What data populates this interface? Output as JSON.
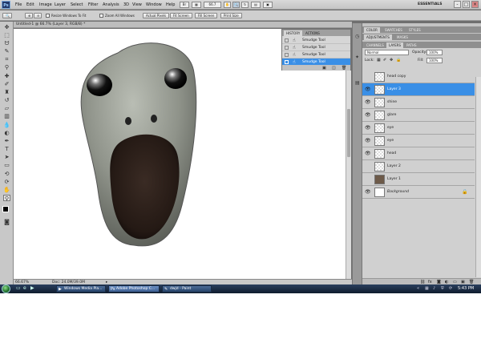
{
  "menubar": {
    "logo": "Ps",
    "items": [
      "File",
      "Edit",
      "Image",
      "Layer",
      "Select",
      "Filter",
      "Analysis",
      "3D",
      "View",
      "Window",
      "Help"
    ],
    "zoom": "66.7",
    "workspace": "ESSENTIALS",
    "window_controls": [
      "-",
      "□",
      "×"
    ]
  },
  "options": {
    "resize_windows": "Resize Windows To Fit",
    "zoom_all": "Zoom All Windows",
    "actual_pixels": "Actual Pixels",
    "fit_screen": "Fit Screen",
    "fill_screen": "Fill Screen",
    "print_size": "Print Size"
  },
  "document": {
    "title": "Untitled-1 @ 66.7% (Layer 3, RGB/8) *"
  },
  "status": {
    "zoom": "66.67%",
    "doc": "Doc: 24.0M/39.0M"
  },
  "history": {
    "tabs": [
      "HISTORY",
      "ACTIONS"
    ],
    "items": [
      "Smudge Tool",
      "Smudge Tool",
      "Smudge Tool",
      "Smudge Tool"
    ]
  },
  "panels": {
    "top_tabs": [
      "COLOR",
      "SWATCHES",
      "STYLES"
    ],
    "adj_tabs": [
      "ADJUSTMENTS",
      "MASKS"
    ],
    "layer_tabs": [
      "CHANNELS",
      "LAYERS",
      "PATHS"
    ]
  },
  "layers": {
    "blend_mode": "Normal",
    "opacity_label": "Opacity:",
    "opacity": "100%",
    "lock_label": "Lock:",
    "fill_label": "Fill:",
    "fill": "100%",
    "items": [
      {
        "name": "head copy"
      },
      {
        "name": "Layer 3"
      },
      {
        "name": "shine"
      },
      {
        "name": "glare"
      },
      {
        "name": "eye"
      },
      {
        "name": "eye"
      },
      {
        "name": "head"
      },
      {
        "name": "Layer 2"
      },
      {
        "name": "Layer 1"
      },
      {
        "name": "Background"
      }
    ]
  },
  "taskbar": {
    "buttons": [
      "Windows Media Pla...",
      "Adobe Photoshop C...",
      "dwjd - Paint"
    ],
    "clock": "5:43 PM"
  }
}
